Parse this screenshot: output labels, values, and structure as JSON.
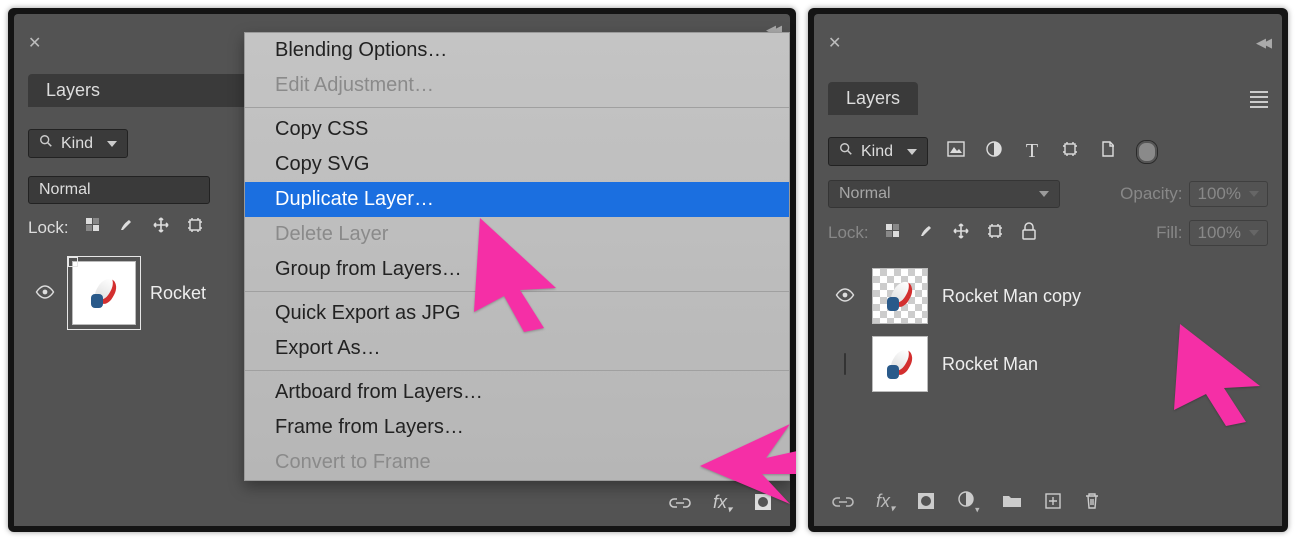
{
  "left": {
    "tab_title": "Layers",
    "kind_label": "Kind",
    "blend_mode": "Normal",
    "lock_label": "Lock:",
    "layer": {
      "name": "Rocket"
    },
    "menu": {
      "blending_options": "Blending Options…",
      "edit_adjustment": "Edit Adjustment…",
      "copy_css": "Copy CSS",
      "copy_svg": "Copy SVG",
      "duplicate_layer": "Duplicate Layer…",
      "delete_layer": "Delete Layer",
      "group_from_layers": "Group from Layers…",
      "quick_export": "Quick Export as JPG",
      "export_as": "Export As…",
      "artboard_from_layers": "Artboard from Layers…",
      "frame_from_layers": "Frame from Layers…",
      "convert_to_frame": "Convert to Frame"
    }
  },
  "right": {
    "tab_title": "Layers",
    "kind_label": "Kind",
    "blend_mode": "Normal",
    "opacity_label": "Opacity:",
    "opacity_value": "100%",
    "lock_label": "Lock:",
    "fill_label": "Fill:",
    "fill_value": "100%",
    "layers": [
      {
        "name": "Rocket Man copy"
      },
      {
        "name": "Rocket Man"
      }
    ]
  }
}
